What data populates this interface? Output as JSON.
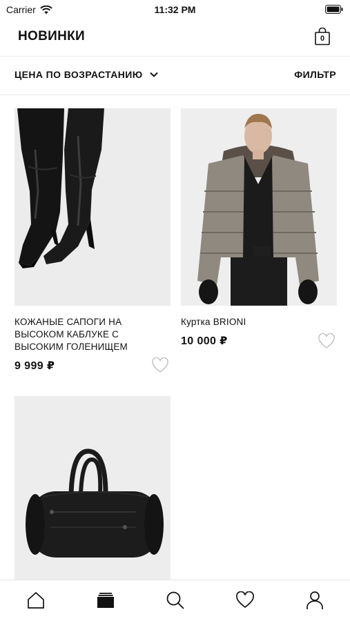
{
  "status_bar": {
    "carrier": "Carrier",
    "time": "11:32 PM"
  },
  "header": {
    "title": "НОВИНКИ",
    "bag_count": "0"
  },
  "toolbar": {
    "sort_label": "ЦЕНА ПО ВОЗРАСТАНИЮ",
    "filter_label": "ФИЛЬТР"
  },
  "products": [
    {
      "name": "КОЖАНЫЕ САПОГИ НА ВЫСОКОМ КАБЛУКЕ С ВЫСОКИМ ГОЛЕНИЩЕМ",
      "price": "9 999 ₽",
      "image": "boots"
    },
    {
      "name": "Куртка BRIONI",
      "price": "10 000 ₽",
      "image": "puffer-jacket"
    },
    {
      "name": "",
      "price": "",
      "image": "duffel-bag"
    }
  ],
  "tab_bar": [
    "home-icon",
    "catalog-icon",
    "search-icon",
    "heart-icon",
    "profile-icon"
  ]
}
